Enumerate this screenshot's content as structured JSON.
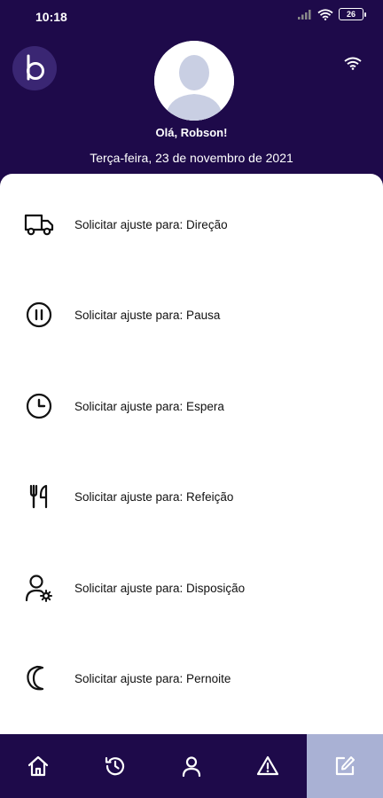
{
  "status_bar": {
    "time": "10:18",
    "battery": "26"
  },
  "header": {
    "logo_letter": "b",
    "greeting": "Olá, Robson!",
    "date": "Terça-feira, 23 de novembro de 2021"
  },
  "menu": {
    "items": [
      {
        "icon": "truck-icon",
        "label": "Solicitar ajuste para: Direção"
      },
      {
        "icon": "pause-icon",
        "label": "Solicitar ajuste para: Pausa"
      },
      {
        "icon": "clock-icon",
        "label": "Solicitar ajuste para: Espera"
      },
      {
        "icon": "fork-knife-icon",
        "label": "Solicitar ajuste para: Refeição"
      },
      {
        "icon": "user-settings-icon",
        "label": "Solicitar ajuste para: Disposição"
      },
      {
        "icon": "moon-icon",
        "label": "Solicitar ajuste para: Pernoite"
      }
    ]
  },
  "bottom_nav": {
    "items": [
      {
        "icon": "home-icon"
      },
      {
        "icon": "history-icon"
      },
      {
        "icon": "profile-icon"
      },
      {
        "icon": "warning-icon"
      },
      {
        "icon": "edit-icon",
        "active": true
      }
    ]
  },
  "colors": {
    "header_bg": "#1e0a4a",
    "active_nav_bg": "#a9b1d4",
    "content_bg": "#ffffff"
  }
}
